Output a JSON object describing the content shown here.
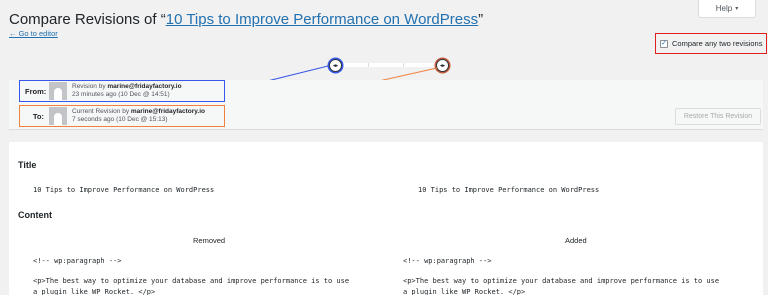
{
  "help": {
    "label": "Help",
    "caret": "▾"
  },
  "header": {
    "title_prefix": "Compare Revisions of “",
    "post_title": "10 Tips to Improve Performance on WordPress",
    "title_suffix": "”",
    "go_to_editor": "← Go to editor"
  },
  "compare_toggle": {
    "label": "Compare any two revisions",
    "checked": true,
    "check_glyph": "✓"
  },
  "slider": {
    "handle_glyph": "◂▸"
  },
  "from": {
    "label": "From:",
    "prefix": "Revision by ",
    "author": "marine@fridayfactory.io",
    "time": "23 minutes ago (10 Dec @ 14:51)"
  },
  "to": {
    "label": "To:",
    "prefix": "Current Revision by ",
    "author": "marine@fridayfactory.io",
    "time": "7 seconds ago (10 Dec @ 15:13)"
  },
  "restore_button": "Restore This Revision",
  "diff": {
    "title_heading": "Title",
    "title_left": "10 Tips to Improve Performance on WordPress",
    "title_right": "10 Tips to Improve Performance on WordPress",
    "content_heading": "Content",
    "removed_label": "Removed",
    "added_label": "Added",
    "left_line1": "<!-- wp:paragraph -->",
    "right_line1": "<!-- wp:paragraph -->",
    "left_line2": "<p>The best way to optimize your database and improve performance is to use",
    "right_line2": "<p>The best way to optimize your database and improve performance is to use",
    "left_line3": "a plugin like WP Rocket. </p>",
    "right_line3": "a plugin like WP Rocket. </p>"
  },
  "colors": {
    "from_outline": "#3858e9",
    "to_outline": "#f0813c",
    "compare_outline": "#e02020",
    "link": "#2271b1"
  }
}
